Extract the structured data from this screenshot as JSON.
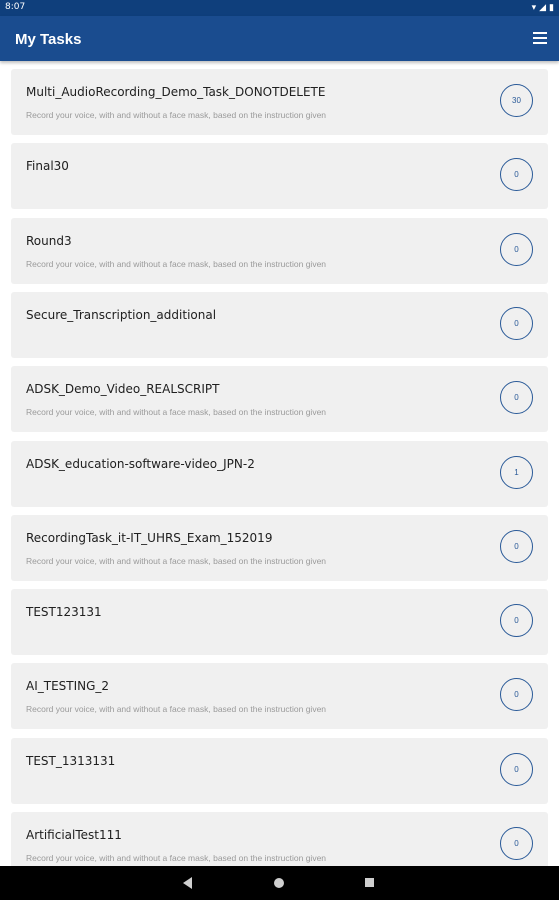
{
  "status_bar": {
    "time": "8:07",
    "icons": [
      "wifi-icon",
      "signal-icon",
      "battery-icon"
    ]
  },
  "app_bar": {
    "title": "My Tasks",
    "menu_icon": "hamburger-menu-icon"
  },
  "colors": {
    "app_bar": "#1a4c8f",
    "status_bar": "#0f3f7c",
    "accent": "#2a5a98",
    "card": "#f0f0f0"
  },
  "tasks": [
    {
      "title": "Multi_AudioRecording_Demo_Task_DONOTDELETE",
      "description": "Record your voice, with and without a face mask, based on the instruction given",
      "count": "30"
    },
    {
      "title": "Final30",
      "description": "",
      "count": "0"
    },
    {
      "title": "Round3",
      "description": "Record your voice, with and without a face mask, based on the instruction given",
      "count": "0"
    },
    {
      "title": "Secure_Transcription_additional",
      "description": "",
      "count": "0"
    },
    {
      "title": "ADSK_Demo_Video_REALSCRIPT",
      "description": "Record your voice, with and without a face mask, based on the instruction given",
      "count": "0"
    },
    {
      "title": "ADSK_education-software-video_JPN-2",
      "description": "",
      "count": "1"
    },
    {
      "title": "RecordingTask_it-IT_UHRS_Exam_152019",
      "description": "Record your voice, with and without a face mask, based on the instruction given",
      "count": "0"
    },
    {
      "title": "TEST123131",
      "description": "",
      "count": "0"
    },
    {
      "title": "AI_TESTING_2",
      "description": "Record your voice, with and without a face mask, based on the instruction given",
      "count": "0"
    },
    {
      "title": "TEST_1313131",
      "description": "",
      "count": "0"
    },
    {
      "title": "ArtificialTest111",
      "description": "Record your voice, with and without a face mask, based on the instruction given",
      "count": "0"
    }
  ],
  "nav_bar": {
    "icons": [
      "back-icon",
      "home-icon",
      "recents-icon"
    ]
  }
}
